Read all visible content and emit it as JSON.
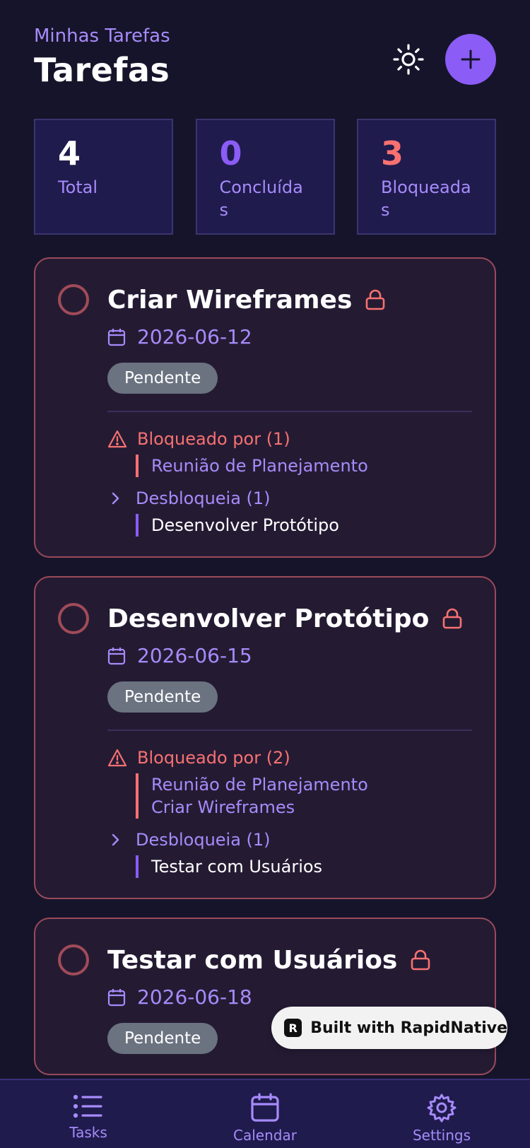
{
  "header": {
    "subtitle": "Minhas Tarefas",
    "title": "Tarefas"
  },
  "stats": [
    {
      "value": "4",
      "label": "Total",
      "color": "#ffffff"
    },
    {
      "value": "0",
      "label": "Concluídas",
      "color": "#8b5cf6"
    },
    {
      "value": "3",
      "label": "Bloqueadas",
      "color": "#f87171"
    }
  ],
  "tasks": [
    {
      "title": "Criar Wireframes",
      "date": "2026-06-12",
      "status": "Pendente",
      "blocked_by_label": "Bloqueado por (1)",
      "blocked_by": [
        "Reunião de Planejamento"
      ],
      "unblocks_label": "Desbloqueia (1)",
      "unblocks": [
        "Desenvolver Protótipo"
      ]
    },
    {
      "title": "Desenvolver Protótipo",
      "date": "2026-06-15",
      "status": "Pendente",
      "blocked_by_label": "Bloqueado por (2)",
      "blocked_by": [
        "Reunião de Planejamento",
        "Criar Wireframes"
      ],
      "unblocks_label": "Desbloqueia (1)",
      "unblocks": [
        "Testar com Usuários"
      ]
    },
    {
      "title": "Testar com Usuários",
      "date": "2026-06-18",
      "status": "Pendente"
    }
  ],
  "toast": {
    "text": "Built with RapidNative"
  },
  "tabs": [
    {
      "label": "Tasks",
      "icon": "list-icon"
    },
    {
      "label": "Calendar",
      "icon": "calendar-icon"
    },
    {
      "label": "Settings",
      "icon": "gear-icon"
    }
  ],
  "colors": {
    "background": "#16142a",
    "accent": "#8b5cf6",
    "blocked": "#f87171",
    "card": "#241b33"
  }
}
